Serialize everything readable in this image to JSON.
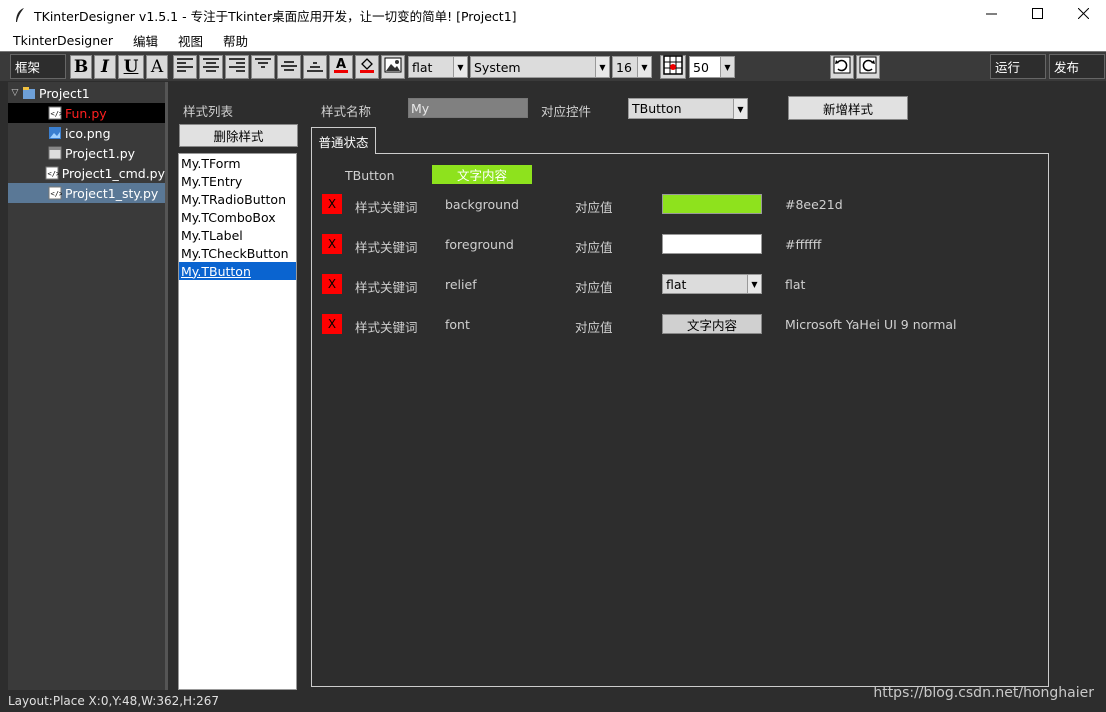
{
  "window": {
    "title": "TKinterDesigner v1.5.1 - 专注于Tkinter桌面应用开发，让一切变的简单!    [Project1]"
  },
  "menu": [
    "TkinterDesigner",
    "编辑",
    "视图",
    "帮助"
  ],
  "toolbar": {
    "frame_label": "框架",
    "bold": "B",
    "italic": "I",
    "underline": "U",
    "font_a": "A",
    "relief_value": "flat",
    "font_family": "System",
    "font_size": "16",
    "zoom": "50",
    "run": "运行",
    "publish": "发布"
  },
  "tree": {
    "root": "Project1",
    "files": [
      {
        "name": "Fun.py",
        "icon": "python-file-icon",
        "color": "#ff2020"
      },
      {
        "name": "ico.png",
        "icon": "image-file-icon",
        "color": "#ffffff"
      },
      {
        "name": "Project1.py",
        "icon": "project-file-icon",
        "color": "#ffffff"
      },
      {
        "name": "Project1_cmd.py",
        "icon": "python-file-icon",
        "color": "#ffffff"
      },
      {
        "name": "Project1_sty.py",
        "icon": "python-file-icon",
        "color": "#ffffff"
      }
    ]
  },
  "styles": {
    "list_label": "样式列表",
    "delete_button": "删除样式",
    "items": [
      "My.TForm",
      "My.TEntry",
      "My.TRadioButton",
      "My.TComboBox",
      "My.TLabel",
      "My.TCheckButton",
      "My.TButton"
    ],
    "selected_index": 6,
    "name_label": "样式名称",
    "name_value": "My",
    "widget_label": "对应控件",
    "widget_value": "TButton",
    "add_button": "新增样式"
  },
  "tab": {
    "label": "普通状态",
    "preview_widget": "TButton",
    "preview_text": "文字内容",
    "preview_bg": "#8ee21d"
  },
  "rows": [
    {
      "x": "X",
      "key_label": "样式关键词",
      "key": "background",
      "val_label": "对应值",
      "kind": "color",
      "color": "#8ee21d",
      "value": "#8ee21d"
    },
    {
      "x": "X",
      "key_label": "样式关键词",
      "key": "foreground",
      "val_label": "对应值",
      "kind": "color",
      "color": "#ffffff",
      "value": "#ffffff"
    },
    {
      "x": "X",
      "key_label": "样式关键词",
      "key": "relief",
      "val_label": "对应值",
      "kind": "combo",
      "combo": "flat",
      "value": "flat"
    },
    {
      "x": "X",
      "key_label": "样式关键词",
      "key": "font",
      "val_label": "对应值",
      "kind": "button",
      "button": "文字内容",
      "value": "Microsoft YaHei UI 9 normal"
    }
  ],
  "status": {
    "text": "Layout:Place  X:0,Y:48,W:362,H:267"
  },
  "watermark": "https://blog.csdn.net/honghaier"
}
